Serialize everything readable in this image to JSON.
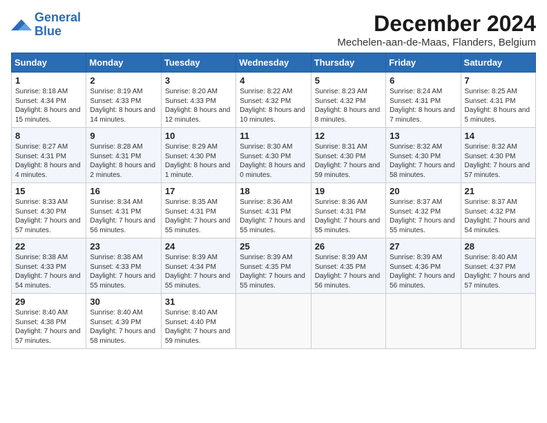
{
  "logo": {
    "text1": "General",
    "text2": "Blue"
  },
  "title": "December 2024",
  "location": "Mechelen-aan-de-Maas, Flanders, Belgium",
  "weekdays": [
    "Sunday",
    "Monday",
    "Tuesday",
    "Wednesday",
    "Thursday",
    "Friday",
    "Saturday"
  ],
  "weeks": [
    [
      {
        "day": "1",
        "sunrise": "8:18 AM",
        "sunset": "4:34 PM",
        "daylight": "8 hours and 15 minutes."
      },
      {
        "day": "2",
        "sunrise": "8:19 AM",
        "sunset": "4:33 PM",
        "daylight": "8 hours and 14 minutes."
      },
      {
        "day": "3",
        "sunrise": "8:20 AM",
        "sunset": "4:33 PM",
        "daylight": "8 hours and 12 minutes."
      },
      {
        "day": "4",
        "sunrise": "8:22 AM",
        "sunset": "4:32 PM",
        "daylight": "8 hours and 10 minutes."
      },
      {
        "day": "5",
        "sunrise": "8:23 AM",
        "sunset": "4:32 PM",
        "daylight": "8 hours and 8 minutes."
      },
      {
        "day": "6",
        "sunrise": "8:24 AM",
        "sunset": "4:31 PM",
        "daylight": "8 hours and 7 minutes."
      },
      {
        "day": "7",
        "sunrise": "8:25 AM",
        "sunset": "4:31 PM",
        "daylight": "8 hours and 5 minutes."
      }
    ],
    [
      {
        "day": "8",
        "sunrise": "8:27 AM",
        "sunset": "4:31 PM",
        "daylight": "8 hours and 4 minutes."
      },
      {
        "day": "9",
        "sunrise": "8:28 AM",
        "sunset": "4:31 PM",
        "daylight": "8 hours and 2 minutes."
      },
      {
        "day": "10",
        "sunrise": "8:29 AM",
        "sunset": "4:30 PM",
        "daylight": "8 hours and 1 minute."
      },
      {
        "day": "11",
        "sunrise": "8:30 AM",
        "sunset": "4:30 PM",
        "daylight": "8 hours and 0 minutes."
      },
      {
        "day": "12",
        "sunrise": "8:31 AM",
        "sunset": "4:30 PM",
        "daylight": "7 hours and 59 minutes."
      },
      {
        "day": "13",
        "sunrise": "8:32 AM",
        "sunset": "4:30 PM",
        "daylight": "7 hours and 58 minutes."
      },
      {
        "day": "14",
        "sunrise": "8:32 AM",
        "sunset": "4:30 PM",
        "daylight": "7 hours and 57 minutes."
      }
    ],
    [
      {
        "day": "15",
        "sunrise": "8:33 AM",
        "sunset": "4:30 PM",
        "daylight": "7 hours and 57 minutes."
      },
      {
        "day": "16",
        "sunrise": "8:34 AM",
        "sunset": "4:31 PM",
        "daylight": "7 hours and 56 minutes."
      },
      {
        "day": "17",
        "sunrise": "8:35 AM",
        "sunset": "4:31 PM",
        "daylight": "7 hours and 55 minutes."
      },
      {
        "day": "18",
        "sunrise": "8:36 AM",
        "sunset": "4:31 PM",
        "daylight": "7 hours and 55 minutes."
      },
      {
        "day": "19",
        "sunrise": "8:36 AM",
        "sunset": "4:31 PM",
        "daylight": "7 hours and 55 minutes."
      },
      {
        "day": "20",
        "sunrise": "8:37 AM",
        "sunset": "4:32 PM",
        "daylight": "7 hours and 55 minutes."
      },
      {
        "day": "21",
        "sunrise": "8:37 AM",
        "sunset": "4:32 PM",
        "daylight": "7 hours and 54 minutes."
      }
    ],
    [
      {
        "day": "22",
        "sunrise": "8:38 AM",
        "sunset": "4:33 PM",
        "daylight": "7 hours and 54 minutes."
      },
      {
        "day": "23",
        "sunrise": "8:38 AM",
        "sunset": "4:33 PM",
        "daylight": "7 hours and 55 minutes."
      },
      {
        "day": "24",
        "sunrise": "8:39 AM",
        "sunset": "4:34 PM",
        "daylight": "7 hours and 55 minutes."
      },
      {
        "day": "25",
        "sunrise": "8:39 AM",
        "sunset": "4:35 PM",
        "daylight": "7 hours and 55 minutes."
      },
      {
        "day": "26",
        "sunrise": "8:39 AM",
        "sunset": "4:35 PM",
        "daylight": "7 hours and 56 minutes."
      },
      {
        "day": "27",
        "sunrise": "8:39 AM",
        "sunset": "4:36 PM",
        "daylight": "7 hours and 56 minutes."
      },
      {
        "day": "28",
        "sunrise": "8:40 AM",
        "sunset": "4:37 PM",
        "daylight": "7 hours and 57 minutes."
      }
    ],
    [
      {
        "day": "29",
        "sunrise": "8:40 AM",
        "sunset": "4:38 PM",
        "daylight": "7 hours and 57 minutes."
      },
      {
        "day": "30",
        "sunrise": "8:40 AM",
        "sunset": "4:39 PM",
        "daylight": "7 hours and 58 minutes."
      },
      {
        "day": "31",
        "sunrise": "8:40 AM",
        "sunset": "4:40 PM",
        "daylight": "7 hours and 59 minutes."
      },
      null,
      null,
      null,
      null
    ]
  ]
}
